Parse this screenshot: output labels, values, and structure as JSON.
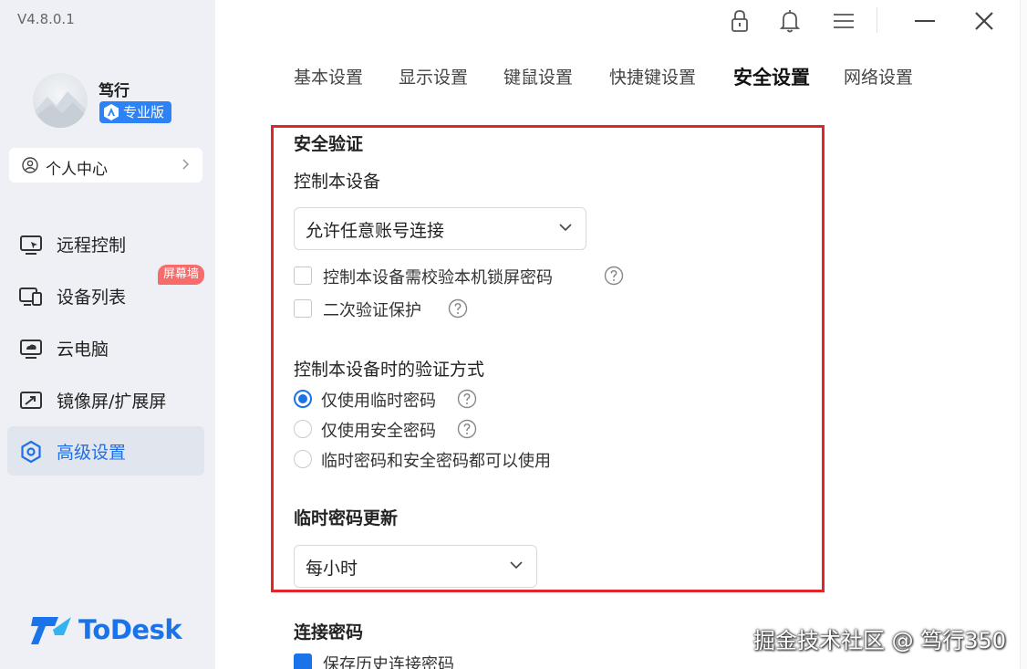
{
  "app": {
    "version": "V4.8.0.1",
    "logo_text": "ToDesk",
    "brand_color": "#1a73e8"
  },
  "user": {
    "name": "笃行",
    "plan": "专业版"
  },
  "sidebar": {
    "personal_center": "个人中心",
    "items": [
      {
        "label": "远程控制",
        "icon": "remote-control-icon",
        "active": false
      },
      {
        "label": "设备列表",
        "icon": "device-list-icon",
        "active": false
      },
      {
        "label": "云电脑",
        "icon": "cloud-pc-icon",
        "active": false
      },
      {
        "label": "镜像屏/扩展屏",
        "icon": "mirror-screen-icon",
        "active": false
      },
      {
        "label": "高级设置",
        "icon": "advanced-settings-icon",
        "active": true
      }
    ],
    "screen_wall_badge": "屏幕墙"
  },
  "topbar": {
    "icons": [
      "lock-icon",
      "bell-icon",
      "menu-icon",
      "minimize-icon",
      "close-icon"
    ]
  },
  "tabs": [
    {
      "label": "基本设置",
      "active": false
    },
    {
      "label": "显示设置",
      "active": false
    },
    {
      "label": "键鼠设置",
      "active": false
    },
    {
      "label": "快捷键设置",
      "active": false
    },
    {
      "label": "安全设置",
      "active": true
    },
    {
      "label": "网络设置",
      "active": false
    }
  ],
  "security": {
    "section_title": "安全验证",
    "control_device_label": "控制本设备",
    "control_device_select": "允许任意账号连接",
    "checkbox_lock_password": "控制本设备需校验本机锁屏密码",
    "checkbox_two_factor": "二次验证保护",
    "verify_method_label": "控制本设备时的验证方式",
    "verify_options": [
      {
        "label": "仅使用临时密码",
        "selected": true
      },
      {
        "label": "仅使用安全密码",
        "selected": false
      },
      {
        "label": "临时密码和安全密码都可以使用",
        "selected": false
      }
    ],
    "temp_password_update_title": "临时密码更新",
    "temp_password_update_select": "每小时",
    "connection_password_title": "连接密码",
    "save_history_checkbox": "保存历史连接密码"
  },
  "watermark": "掘金技术社区 @ 笃行350",
  "highlight_color": "#e0262b"
}
